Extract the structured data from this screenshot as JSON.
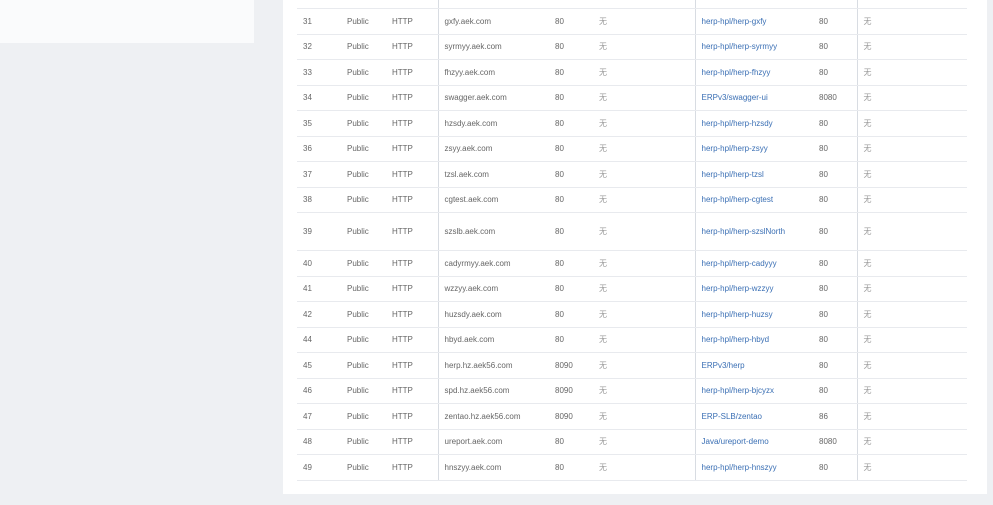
{
  "rows": [
    {
      "no": "31",
      "scope": "Public",
      "protocol": "HTTP",
      "domain": "gxfy.aek.com",
      "port": "80",
      "cert": "无",
      "target": "herp-hpl/herp-gxfy",
      "target_port": "80",
      "note": "无"
    },
    {
      "no": "32",
      "scope": "Public",
      "protocol": "HTTP",
      "domain": "syrmyy.aek.com",
      "port": "80",
      "cert": "无",
      "target": "herp-hpl/herp-syrmyy",
      "target_port": "80",
      "note": "无"
    },
    {
      "no": "33",
      "scope": "Public",
      "protocol": "HTTP",
      "domain": "fhzyy.aek.com",
      "port": "80",
      "cert": "无",
      "target": "herp-hpl/herp-fhzyy",
      "target_port": "80",
      "note": "无"
    },
    {
      "no": "34",
      "scope": "Public",
      "protocol": "HTTP",
      "domain": "swagger.aek.com",
      "port": "80",
      "cert": "无",
      "target": "ERPv3/swagger-ui",
      "target_port": "8080",
      "note": "无"
    },
    {
      "no": "35",
      "scope": "Public",
      "protocol": "HTTP",
      "domain": "hzsdy.aek.com",
      "port": "80",
      "cert": "无",
      "target": "herp-hpl/herp-hzsdy",
      "target_port": "80",
      "note": "无"
    },
    {
      "no": "36",
      "scope": "Public",
      "protocol": "HTTP",
      "domain": "zsyy.aek.com",
      "port": "80",
      "cert": "无",
      "target": "herp-hpl/herp-zsyy",
      "target_port": "80",
      "note": "无"
    },
    {
      "no": "37",
      "scope": "Public",
      "protocol": "HTTP",
      "domain": "tzsl.aek.com",
      "port": "80",
      "cert": "无",
      "target": "herp-hpl/herp-tzsl",
      "target_port": "80",
      "note": "无"
    },
    {
      "no": "38",
      "scope": "Public",
      "protocol": "HTTP",
      "domain": "cgtest.aek.com",
      "port": "80",
      "cert": "无",
      "target": "herp-hpl/herp-cgtest",
      "target_port": "80",
      "note": "无"
    },
    {
      "no": "39",
      "scope": "Public",
      "protocol": "HTTP",
      "domain": "szslb.aek.com",
      "port": "80",
      "cert": "无",
      "target": "herp-hpl/herp-szslNorth",
      "target_port": "80",
      "note": "无"
    },
    {
      "no": "40",
      "scope": "Public",
      "protocol": "HTTP",
      "domain": "cadyrmyy.aek.com",
      "port": "80",
      "cert": "无",
      "target": "herp-hpl/herp-cadyyy",
      "target_port": "80",
      "note": "无"
    },
    {
      "no": "41",
      "scope": "Public",
      "protocol": "HTTP",
      "domain": "wzzyy.aek.com",
      "port": "80",
      "cert": "无",
      "target": "herp-hpl/herp-wzzyy",
      "target_port": "80",
      "note": "无"
    },
    {
      "no": "42",
      "scope": "Public",
      "protocol": "HTTP",
      "domain": "huzsdy.aek.com",
      "port": "80",
      "cert": "无",
      "target": "herp-hpl/herp-huzsy",
      "target_port": "80",
      "note": "无"
    },
    {
      "no": "44",
      "scope": "Public",
      "protocol": "HTTP",
      "domain": "hbyd.aek.com",
      "port": "80",
      "cert": "无",
      "target": "herp-hpl/herp-hbyd",
      "target_port": "80",
      "note": "无"
    },
    {
      "no": "45",
      "scope": "Public",
      "protocol": "HTTP",
      "domain": "herp.hz.aek56.com",
      "port": "8090",
      "cert": "无",
      "target": "ERPv3/herp",
      "target_port": "80",
      "note": "无"
    },
    {
      "no": "46",
      "scope": "Public",
      "protocol": "HTTP",
      "domain": "spd.hz.aek56.com",
      "port": "8090",
      "cert": "无",
      "target": "herp-hpl/herp-bjcyzx",
      "target_port": "80",
      "note": "无"
    },
    {
      "no": "47",
      "scope": "Public",
      "protocol": "HTTP",
      "domain": "zentao.hz.aek56.com",
      "port": "8090",
      "cert": "无",
      "target": "ERP-SLB/zentao",
      "target_port": "86",
      "note": "无"
    },
    {
      "no": "48",
      "scope": "Public",
      "protocol": "HTTP",
      "domain": "ureport.aek.com",
      "port": "80",
      "cert": "无",
      "target": "Java/ureport-demo",
      "target_port": "8080",
      "note": "无"
    },
    {
      "no": "49",
      "scope": "Public",
      "protocol": "HTTP",
      "domain": "hnszyy.aek.com",
      "port": "80",
      "cert": "无",
      "target": "herp-hpl/herp-hnszyy",
      "target_port": "80",
      "note": "无"
    }
  ]
}
